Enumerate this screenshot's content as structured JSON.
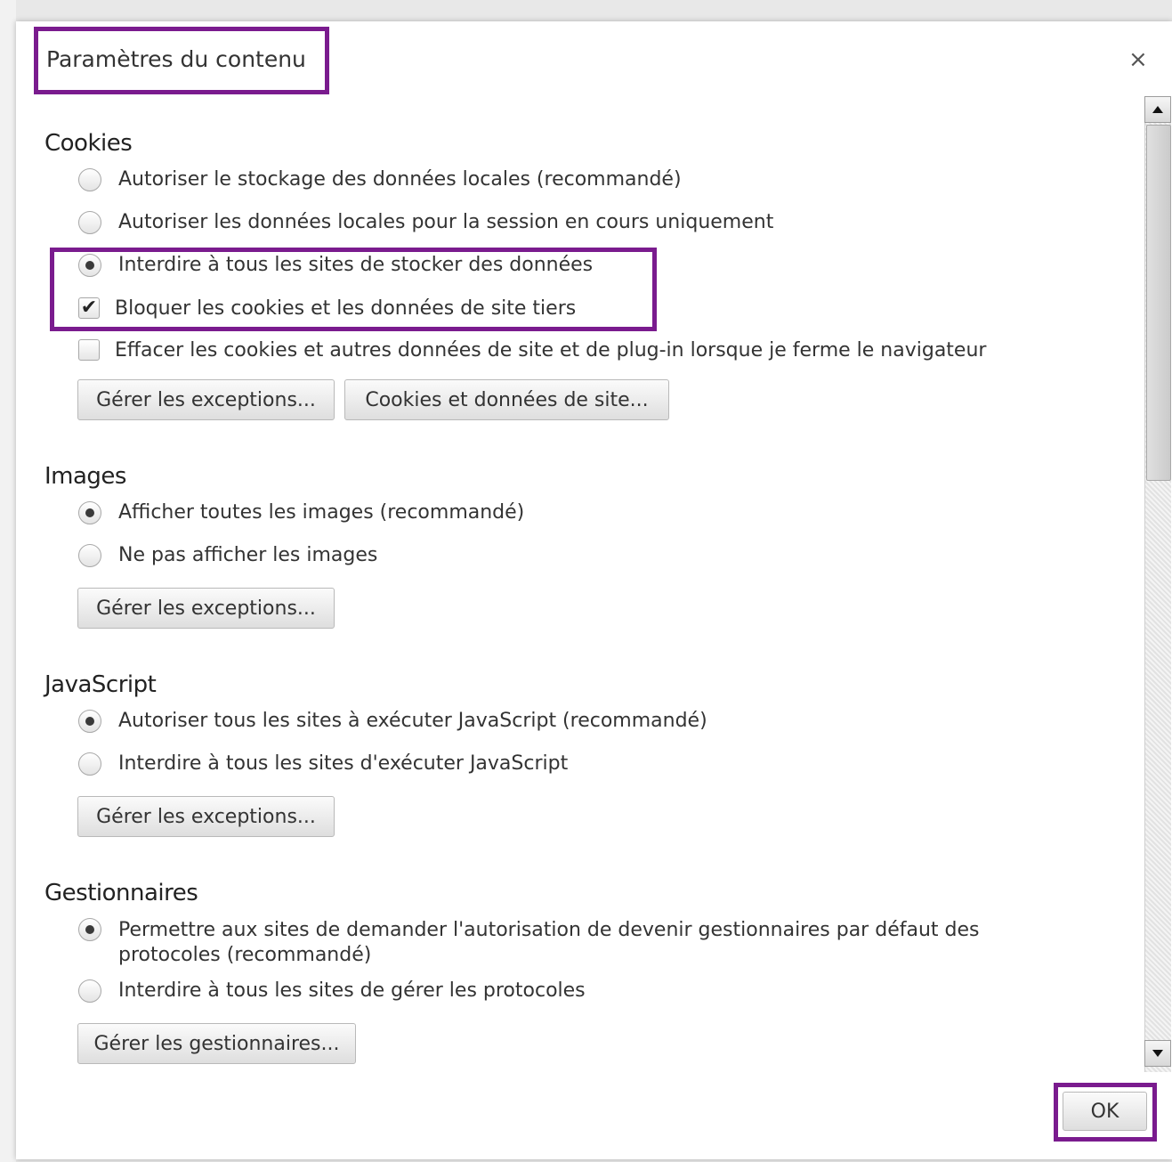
{
  "dialog": {
    "title": "Paramètres du contenu",
    "close_label": "×",
    "ok_label": "OK"
  },
  "cookies": {
    "title": "Cookies",
    "options": [
      {
        "label": "Autoriser le stockage des données locales (recommandé)",
        "checked": false
      },
      {
        "label": "Autoriser les données locales pour la session en cours uniquement",
        "checked": false
      },
      {
        "label": "Interdire à tous les sites de stocker des données",
        "checked": true
      }
    ],
    "checkboxes": [
      {
        "label": "Bloquer les cookies et les données de site tiers",
        "checked": true
      },
      {
        "label": "Effacer les cookies et autres données de site et de plug-in lorsque je ferme le navigateur",
        "checked": false
      }
    ],
    "manage_exceptions": "Gérer les exceptions...",
    "cookies_and_data": "Cookies et données de site..."
  },
  "images": {
    "title": "Images",
    "options": [
      {
        "label": "Afficher toutes les images (recommandé)",
        "checked": true
      },
      {
        "label": "Ne pas afficher les images",
        "checked": false
      }
    ],
    "manage_exceptions": "Gérer les exceptions..."
  },
  "javascript": {
    "title": "JavaScript",
    "options": [
      {
        "label": "Autoriser tous les sites à exécuter JavaScript (recommandé)",
        "checked": true
      },
      {
        "label": "Interdire à tous les sites d'exécuter JavaScript",
        "checked": false
      }
    ],
    "manage_exceptions": "Gérer les exceptions..."
  },
  "handlers": {
    "title": "Gestionnaires",
    "options": [
      {
        "label": "Permettre aux sites de demander l'autorisation de devenir gestionnaires par défaut des protocoles (recommandé)",
        "checked": true
      },
      {
        "label": "Interdire à tous les sites de gérer les protocoles",
        "checked": false
      }
    ],
    "manage_handlers": "Gérer les gestionnaires..."
  },
  "highlight_color": "#7a1b8e"
}
